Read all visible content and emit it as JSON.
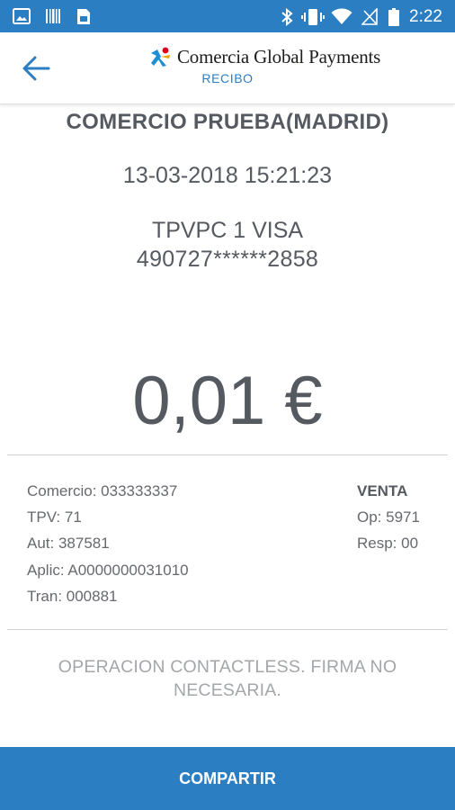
{
  "status_bar": {
    "time": "2:22",
    "icons": [
      "image-icon",
      "barcode-icon",
      "sim-icon",
      "bluetooth-icon",
      "vibrate-icon",
      "wifi-icon",
      "no-signal-icon",
      "battery-icon"
    ]
  },
  "header": {
    "brand_name": "Comercia Global Payments",
    "screen_title": "RECIBO",
    "back_icon": "arrow-back-icon"
  },
  "receipt": {
    "merchant_name": "COMERCIO PRUEBA(MADRID)",
    "datetime": "13-03-2018 15:21:23",
    "card_type": "TPVPC 1 VISA",
    "card_number": "490727******2858",
    "amount": "0,01 €",
    "details_left": [
      "Comercio: 033333337",
      "TPV: 71",
      "Aut: 387581",
      "Aplic: A0000000031010",
      "Tran: 000881"
    ],
    "operation_type": "VENTA",
    "details_right": [
      "Op: 5971",
      "Resp: 00"
    ],
    "notice": "OPERACION CONTACTLESS. FIRMA NO NECESARIA."
  },
  "actions": {
    "share_label": "COMPARTIR"
  },
  "colors": {
    "primary": "#2c7ec2",
    "text": "#555a61",
    "muted": "#a3a6aa"
  }
}
